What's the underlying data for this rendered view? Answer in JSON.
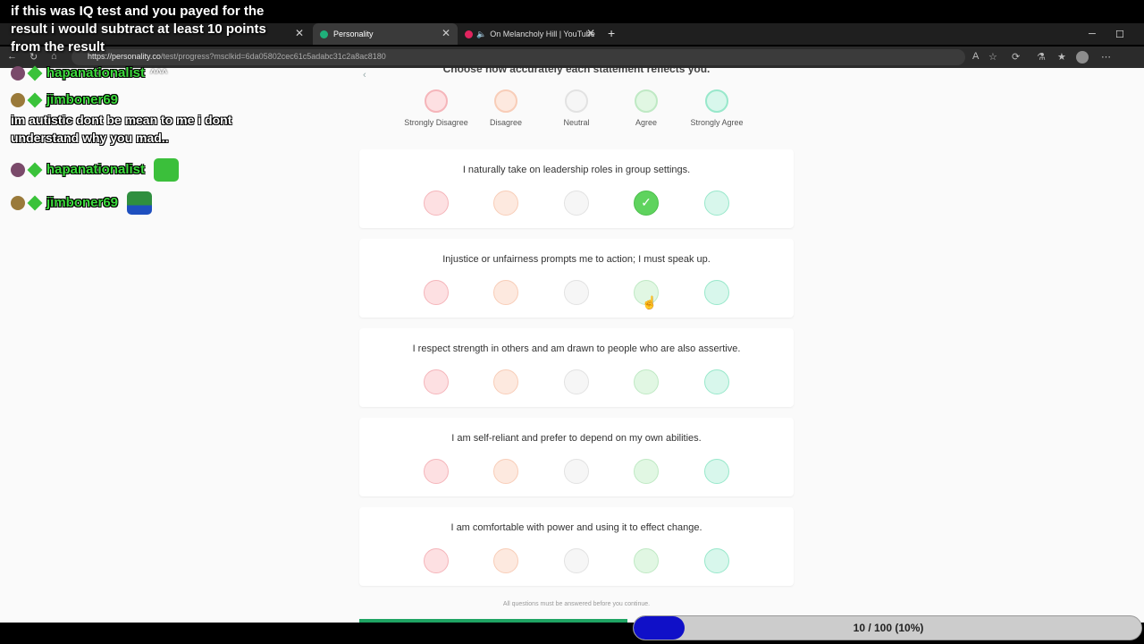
{
  "overlay": {
    "title": "if this was IQ test and you payed for the result i would subtract at least 10 points from the result"
  },
  "chat": [
    {
      "user": "hapanationalist",
      "suffix": "^^^",
      "emote": "green-face-emote"
    },
    {
      "user": "jimboner69",
      "message": "im autistic dont be mean to me i dont understand why you mad.."
    },
    {
      "user": "hapanationalist",
      "emote": "crying-face-emote"
    },
    {
      "user": "jimboner69",
      "emote": "pepe-emote"
    }
  ],
  "browser": {
    "tabs": [
      {
        "label": "Personality",
        "active": true
      },
      {
        "label": "On Melancholy Hill | YouTube"
      }
    ],
    "url_host": "https://personality.co",
    "url_path": "/test/progress?msclkid=6da05802cec61c5adabc31c2a8ac8180"
  },
  "page": {
    "instruction": "Choose how accurately each statement reflects you.",
    "scale": [
      "Strongly Disagree",
      "Disagree",
      "Neutral",
      "Agree",
      "Strongly Agree"
    ],
    "questions": [
      {
        "text": "I naturally take on leadership roles in group settings.",
        "selected": "Agree"
      },
      {
        "text": "Injustice or unfairness prompts me to action; I must speak up.",
        "selected": null
      },
      {
        "text": "I respect strength in others and am drawn to people who are also assertive.",
        "selected": null
      },
      {
        "text": "I am self-reliant and prefer to depend on my own abilities.",
        "selected": null
      },
      {
        "text": "I am comfortable with power and using it to effect change.",
        "selected": null
      }
    ],
    "footer_note": "All questions must be answered before you continue."
  },
  "progress": {
    "label": "10 / 100 (10%)",
    "fraction": 0.1
  },
  "colors": {
    "strongly_disagree": "#fde0e2",
    "disagree": "#fde9df",
    "neutral": "#f6f6f6",
    "agree": "#e1f7e3",
    "strongly_agree": "#d8f7ec",
    "selected": "#5fd35e",
    "progress_fill": "#1010c8"
  }
}
